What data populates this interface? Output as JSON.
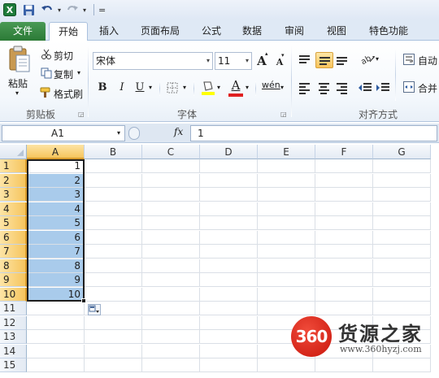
{
  "quick_access": {
    "undo_arrow": "▾",
    "redo_arrow": "▾",
    "customize": "="
  },
  "tabs": [
    {
      "label": "文件"
    },
    {
      "label": "开始"
    },
    {
      "label": "插入"
    },
    {
      "label": "页面布局"
    },
    {
      "label": "公式"
    },
    {
      "label": "数据"
    },
    {
      "label": "审阅"
    },
    {
      "label": "视图"
    },
    {
      "label": "特色功能"
    }
  ],
  "ribbon": {
    "clipboard": {
      "paste": "粘贴",
      "cut": "剪切",
      "copy": "复制",
      "format_painter": "格式刷",
      "group": "剪贴板"
    },
    "font": {
      "font_name": "宋体",
      "font_size": "11",
      "bold": "B",
      "italic": "I",
      "underline": "U",
      "grow": "A",
      "shrink": "A",
      "font_color": "A",
      "wen": "wén",
      "group": "字体"
    },
    "alignment": {
      "wrap": "自动",
      "merge": "合并",
      "group": "对齐方式"
    }
  },
  "formula_bar": {
    "name_box": "A1",
    "fx": "fx",
    "value": "1"
  },
  "sheet": {
    "columns": [
      "A",
      "B",
      "C",
      "D",
      "E",
      "F",
      "G"
    ],
    "rows": [
      "1",
      "2",
      "3",
      "4",
      "5",
      "6",
      "7",
      "8",
      "9",
      "10",
      "11",
      "12",
      "13",
      "14",
      "15"
    ],
    "column_a_values": [
      "1",
      "2",
      "3",
      "4",
      "5",
      "6",
      "7",
      "8",
      "9",
      "10"
    ]
  },
  "watermark": {
    "badge": "360",
    "title": "货源之家",
    "url": "www.360hyzj.com"
  },
  "colors": {
    "file_tab": "#2b7a36",
    "selection": "#a9cbeb",
    "header_highlight": "#f6c55e",
    "watermark_red": "#d8281b"
  }
}
